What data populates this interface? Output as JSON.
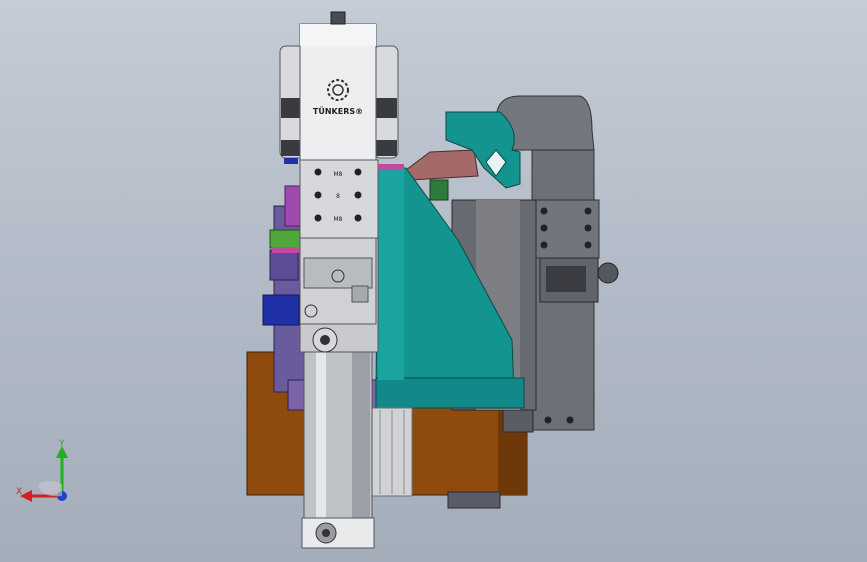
{
  "viewport": {
    "background_top": "#c4ccd6",
    "background_bottom": "#a4adba"
  },
  "model": {
    "brand_text": "TÜNKERS®",
    "hole_labels": [
      "M8",
      "8",
      "M8"
    ],
    "colors": {
      "housing_white": "#eceef0",
      "gray_block": "#7d7e84",
      "teal_bracket": "#14948f",
      "orange_block": "#8f4a0e",
      "purple_plate": "#7a63a6",
      "blue_plate": "#2031a8",
      "pink_arm": "#a46a6a",
      "green_ring": "#4fa63a",
      "cylinder_gray": "#bfc2c7"
    }
  },
  "triad": {
    "x_label": "X",
    "y_label": "Y",
    "colors": {
      "x": "#d42020",
      "y": "#20b020",
      "z": "#2040d0"
    }
  }
}
